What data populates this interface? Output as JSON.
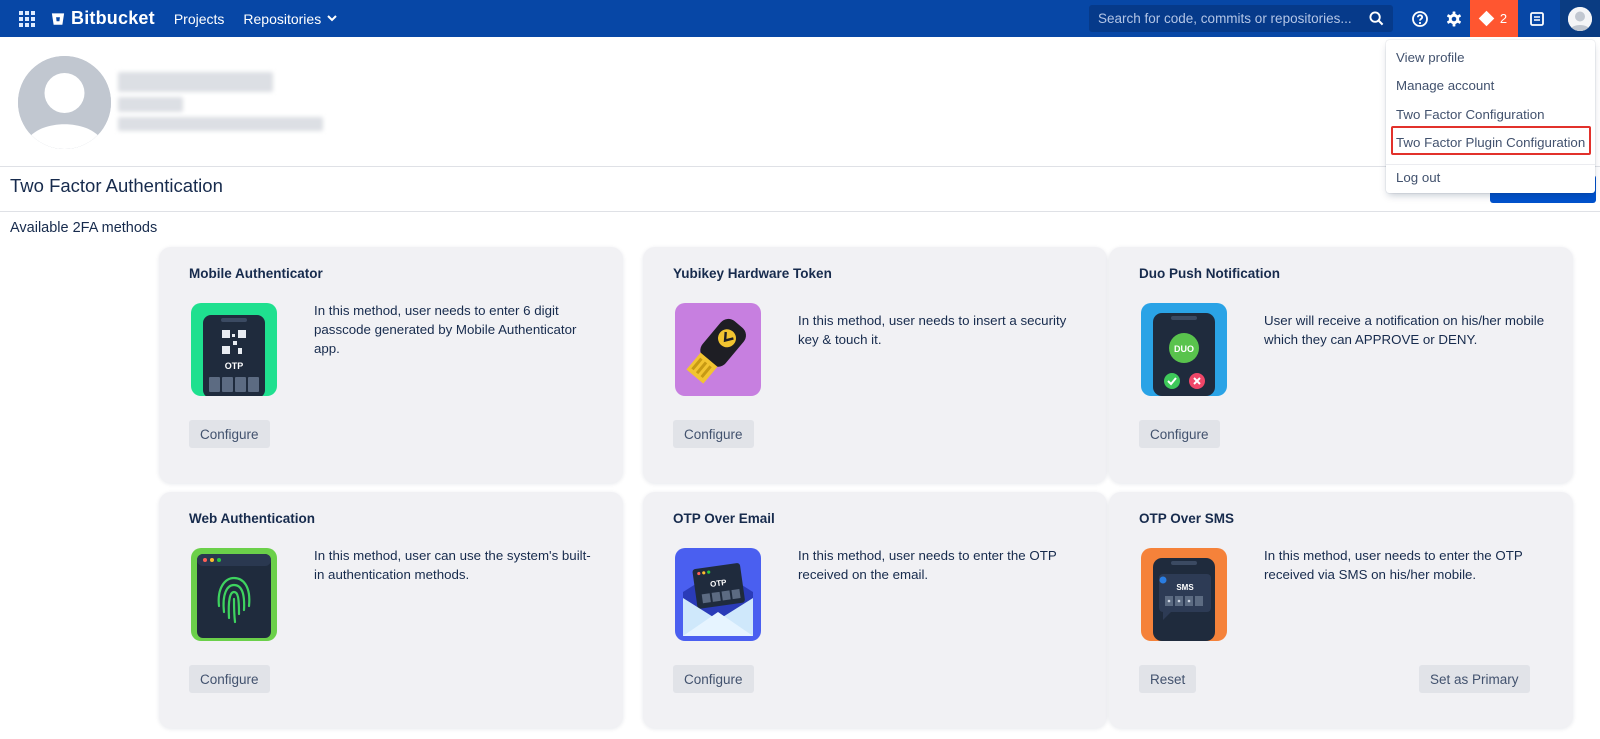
{
  "app": {
    "logo_text": "Bitbucket",
    "nav": {
      "projects": "Projects",
      "repositories": "Repositories"
    },
    "search_placeholder": "Search for code, commits or repositories...",
    "notification_count": "2",
    "colors": {
      "nav_bg": "#0747a6",
      "notif_bg": "#ff5630",
      "highlight": "#e2312b"
    }
  },
  "user_menu": {
    "items": [
      "View profile",
      "Manage account",
      "Two Factor Configuration",
      "Two Factor Plugin Configuration",
      "Log out"
    ]
  },
  "page": {
    "title": "Two Factor Authentication",
    "section_label": "Available 2FA methods"
  },
  "methods": [
    {
      "title": "Mobile Authenticator",
      "description": "In this method, user needs to enter 6 digit passcode generated by Mobile Authenticator app.",
      "image_label": "OTP",
      "actions": [
        "Configure"
      ]
    },
    {
      "title": "Yubikey Hardware Token",
      "description": "In this method, user needs to insert a security key & touch it.",
      "actions": [
        "Configure"
      ]
    },
    {
      "title": "Duo Push Notification",
      "description": "User will receive a notification on his/her mobile which they can APPROVE or DENY.",
      "image_label": "DUO",
      "actions": [
        "Configure"
      ]
    },
    {
      "title": "Web Authentication",
      "description": "In this method, user can use the system's built-in authentication methods.",
      "actions": [
        "Configure"
      ]
    },
    {
      "title": "OTP Over Email",
      "description": "In this method, user needs to enter the OTP received on the email.",
      "image_label": "OTP",
      "actions": [
        "Configure"
      ]
    },
    {
      "title": "OTP Over SMS",
      "description": "In this method, user needs to enter the OTP received via SMS on his/her mobile.",
      "image_label": "SMS",
      "actions": [
        "Reset",
        "Set as Primary"
      ]
    }
  ]
}
